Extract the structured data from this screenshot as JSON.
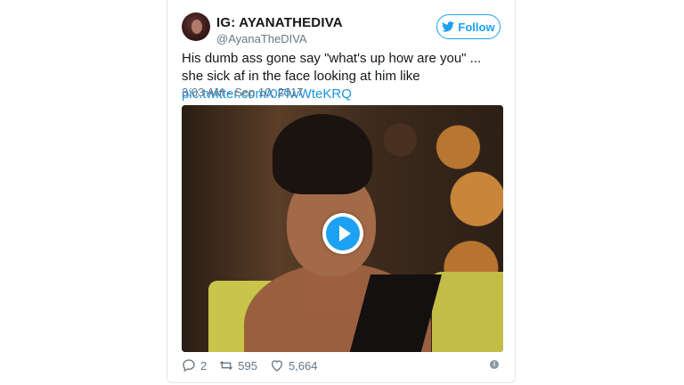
{
  "tweet": {
    "display_name": "IG: AYANATHEDIVA",
    "handle": "@AyanaTheDIVA",
    "follow_label": "Follow",
    "text_main": "His dumb ass gone say \"what's up how are you\" ... she sick af in the face looking at him like ",
    "text_link": "pic.twitter.com/0FfwWteKRQ",
    "timestamp": "3:03 AM - Sep 10, 2017",
    "replies": "2",
    "retweets": "595",
    "likes": "5,664",
    "info_glyph": "i"
  },
  "icons": {
    "avatar": "avatar",
    "follow": "twitter-bird-icon",
    "play": "play-icon",
    "reply": "reply-icon",
    "retweet": "retweet-icon",
    "like": "heart-icon",
    "info": "info-icon"
  },
  "colors": {
    "accent": "#1da1f2",
    "link": "#1b95e0",
    "muted": "#657786",
    "text": "#14171a"
  }
}
